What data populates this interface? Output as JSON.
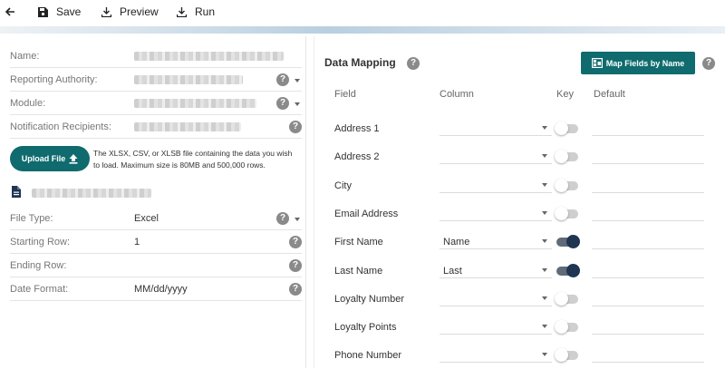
{
  "toolbar": {
    "save_label": "Save",
    "preview_label": "Preview",
    "run_label": "Run"
  },
  "form": {
    "name_label": "Name:",
    "reporting_authority_label": "Reporting Authority:",
    "module_label": "Module:",
    "notification_recipients_label": "Notification Recipients:",
    "upload_button_label": "Upload File",
    "upload_note": "The XLSX, CSV, or XLSB file containing the data you wish to load. Maximum size is 80MB and 500,000 rows.",
    "file_type_label": "File Type:",
    "file_type_value": "Excel",
    "starting_row_label": "Starting Row:",
    "starting_row_value": "1",
    "ending_row_label": "Ending Row:",
    "ending_row_value": "",
    "date_format_label": "Date Format:",
    "date_format_value": "MM/dd/yyyy"
  },
  "mapping": {
    "title": "Data Mapping",
    "map_button_label": "Map Fields by Name",
    "headers": {
      "field": "Field",
      "column": "Column",
      "key": "Key",
      "default": "Default"
    },
    "rows": [
      {
        "field": "Address 1",
        "column": "",
        "key": false,
        "default": ""
      },
      {
        "field": "Address 2",
        "column": "",
        "key": false,
        "default": ""
      },
      {
        "field": "City",
        "column": "",
        "key": false,
        "default": ""
      },
      {
        "field": "Email Address",
        "column": "",
        "key": false,
        "default": ""
      },
      {
        "field": "First Name",
        "column": "Name",
        "key": true,
        "default": ""
      },
      {
        "field": "Last Name",
        "column": "Last",
        "key": true,
        "default": ""
      },
      {
        "field": "Loyalty Number",
        "column": "",
        "key": false,
        "default": ""
      },
      {
        "field": "Loyalty Points",
        "column": "",
        "key": false,
        "default": ""
      },
      {
        "field": "Phone Number",
        "column": "",
        "key": false,
        "default": ""
      }
    ]
  },
  "colors": {
    "accent": "#0f6b6e",
    "toggle_on": "#1f3552"
  }
}
